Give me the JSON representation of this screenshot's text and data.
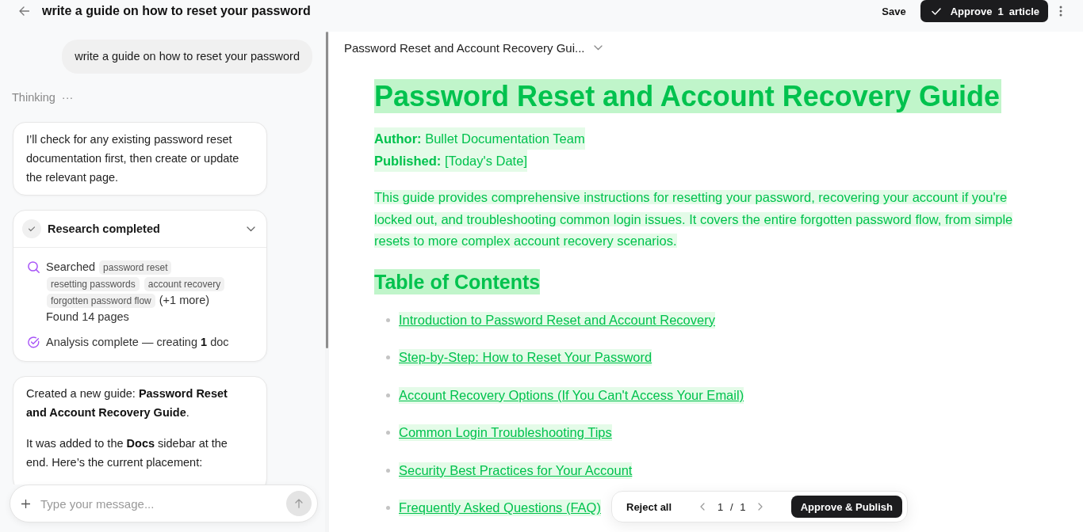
{
  "topbar": {
    "title": "write a guide on how to reset your password",
    "save": "Save",
    "approve": {
      "label": "Approve",
      "count": "1",
      "noun": "article"
    }
  },
  "chat": {
    "user_message": "write a guide on how to reset your password",
    "thinking": {
      "label": "Thinking",
      "dots": "···"
    },
    "note": "I’ll check for any existing password reset documentation first, then create or update the relevant page.",
    "research": {
      "title": "Research completed",
      "expanded": true,
      "searched_label": "Searched",
      "queries": [
        "password reset",
        "resetting passwords",
        "account recovery",
        "forgotten password flow"
      ],
      "more": "(+1 more)",
      "found": "Found 14 pages",
      "analysis": "Analysis complete — creating **1** doc"
    },
    "reply": [
      "Created a new guide: **Password Reset and Account Recovery Guide**.",
      "It was added to the **Docs** sidebar at the end. Here’s the current placement:"
    ],
    "composer": {
      "placeholder": "Type your message..."
    }
  },
  "document": {
    "selector": "Password Reset and Account Recovery Gui...",
    "added": true,
    "title": "Password Reset and Account Recovery Guide",
    "meta": [
      "**Author:** Bullet Documentation Team",
      "**Published:** [Today's Date]"
    ],
    "intro": "This guide provides comprehensive instructions for resetting your password, recovering your account if you're locked out, and troubleshooting common login issues. It covers the entire forgotten password flow, from simple resets to more complex account recovery scenarios.",
    "toc_heading": "Table of Contents",
    "toc": [
      "Introduction to Password Reset and Account Recovery",
      "Step-by-Step: How to Reset Your Password",
      "Account Recovery Options (If You Can't Access Your Email)",
      "Common Login Troubleshooting Tips",
      "Security Best Practices for Your Account",
      "Frequently Asked Questions (FAQ)"
    ]
  },
  "review_bar": {
    "reject": "Reject all",
    "pager": "1 / 1",
    "publish": "Approve & Publish"
  }
}
